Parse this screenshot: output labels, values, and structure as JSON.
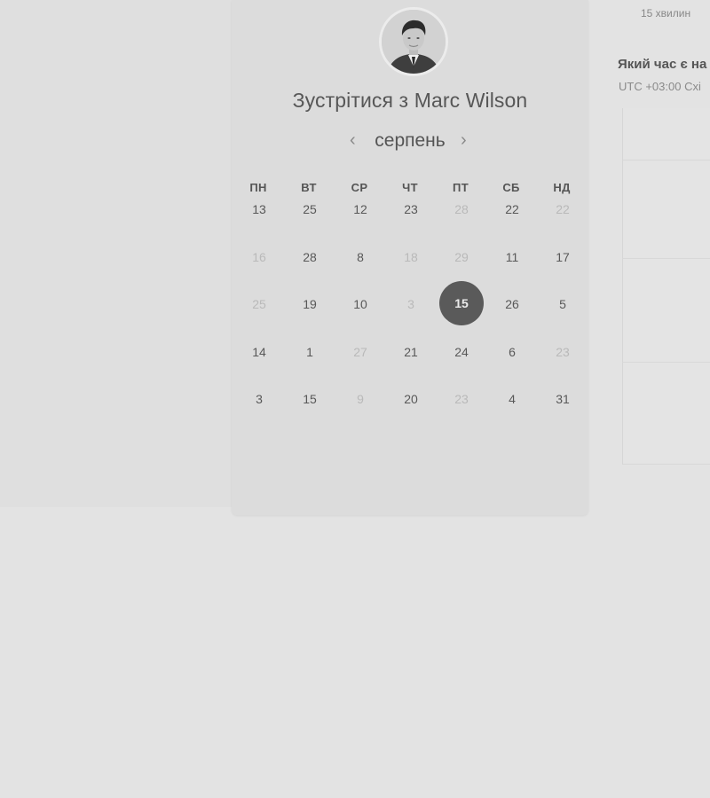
{
  "booking": {
    "title_prefix": "Зустрітися з ",
    "host_name": "Marc Wilson",
    "month": "серпень"
  },
  "weekdays": [
    "ПН",
    "ВТ",
    "СР",
    "ЧТ",
    "ПТ",
    "СБ",
    "НД"
  ],
  "calendar": {
    "rows": [
      [
        {
          "d": "13",
          "muted": false
        },
        {
          "d": "25",
          "muted": false
        },
        {
          "d": "12",
          "muted": false
        },
        {
          "d": "23",
          "muted": false
        },
        {
          "d": "28",
          "muted": true
        },
        {
          "d": "22",
          "muted": false
        },
        {
          "d": "22",
          "muted": true
        }
      ],
      [
        {
          "d": "16",
          "muted": true
        },
        {
          "d": "28",
          "muted": false
        },
        {
          "d": "8",
          "muted": false
        },
        {
          "d": "18",
          "muted": true
        },
        {
          "d": "29",
          "muted": true
        },
        {
          "d": "11",
          "muted": false
        },
        {
          "d": "17",
          "muted": false
        }
      ],
      [
        {
          "d": "25",
          "muted": true
        },
        {
          "d": "19",
          "muted": false
        },
        {
          "d": "10",
          "muted": false
        },
        {
          "d": "3",
          "muted": true
        },
        {
          "d": "15",
          "muted": false,
          "selected": true
        },
        {
          "d": "26",
          "muted": false
        },
        {
          "d": "5",
          "muted": false
        }
      ],
      [
        {
          "d": "14",
          "muted": false
        },
        {
          "d": "1",
          "muted": false
        },
        {
          "d": "27",
          "muted": true
        },
        {
          "d": "21",
          "muted": false
        },
        {
          "d": "24",
          "muted": false
        },
        {
          "d": "6",
          "muted": false
        },
        {
          "d": "23",
          "muted": true
        }
      ],
      [
        {
          "d": "3",
          "muted": false
        },
        {
          "d": "15",
          "muted": false
        },
        {
          "d": "9",
          "muted": true
        },
        {
          "d": "20",
          "muted": false
        },
        {
          "d": "23",
          "muted": true
        },
        {
          "d": "4",
          "muted": false
        },
        {
          "d": "31",
          "muted": false
        }
      ]
    ]
  },
  "side": {
    "duration": "15 хвилин",
    "question": "Який час є на",
    "timezone": "UTC +03:00 Схі"
  },
  "icons": {
    "prev": "chevron-left-icon",
    "next": "chevron-right-icon"
  },
  "colors": {
    "selected_day": "#5a5a5a",
    "muted_day": "#b9b9b9",
    "background": "#e3e3e3",
    "card": "#dcdcdc"
  }
}
